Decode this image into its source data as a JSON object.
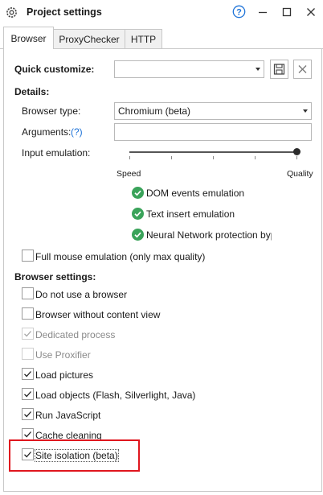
{
  "window": {
    "title": "Project settings",
    "icons": {
      "app": "gear-icon",
      "help": "help-circle-icon",
      "minimize": "minimize-icon",
      "maximize": "maximize-icon",
      "close": "close-icon"
    }
  },
  "tabs": [
    {
      "label": "Browser",
      "active": true
    },
    {
      "label": "ProxyChecker",
      "active": false
    },
    {
      "label": "HTTP",
      "active": false
    }
  ],
  "quick_customize": {
    "label": "Quick customize:",
    "value": "",
    "save_icon": "save-icon",
    "clear_icon": "close-x-icon"
  },
  "details": {
    "heading": "Details:",
    "browser_type_label": "Browser type:",
    "browser_type_value": "Chromium (beta)",
    "arguments_label": "Arguments:",
    "arguments_help": "(?)",
    "arguments_value": "",
    "input_emulation_label": "Input emulation:",
    "slider_min_label": "Speed",
    "slider_max_label": "Quality",
    "slider_level": 1.0,
    "emulation_features": [
      "DOM events emulation",
      "Text insert emulation",
      "Neural Network protection bypas"
    ],
    "full_mouse_label": "Full mouse emulation (only max quality)",
    "full_mouse_checked": false
  },
  "browser_settings": {
    "heading": "Browser settings:",
    "options": [
      {
        "label": "Do not use a browser",
        "checked": false,
        "disabled": false
      },
      {
        "label": "Browser without content view",
        "checked": false,
        "disabled": false
      },
      {
        "label": "Dedicated process",
        "checked": true,
        "disabled": true
      },
      {
        "label": "Use Proxifier",
        "checked": false,
        "disabled": true
      },
      {
        "label": "Load pictures",
        "checked": true,
        "disabled": false
      },
      {
        "label": "Load objects (Flash, Silverlight, Java)",
        "checked": true,
        "disabled": false
      },
      {
        "label": "Run JavaScript",
        "checked": true,
        "disabled": false
      },
      {
        "label": "Cache cleaning",
        "checked": true,
        "disabled": false
      },
      {
        "label": "Site isolation (beta)",
        "checked": true,
        "disabled": false
      }
    ]
  },
  "colors": {
    "accent": "#1e73d8",
    "green_check": "#3aa35a",
    "highlight": "#e0161e"
  }
}
